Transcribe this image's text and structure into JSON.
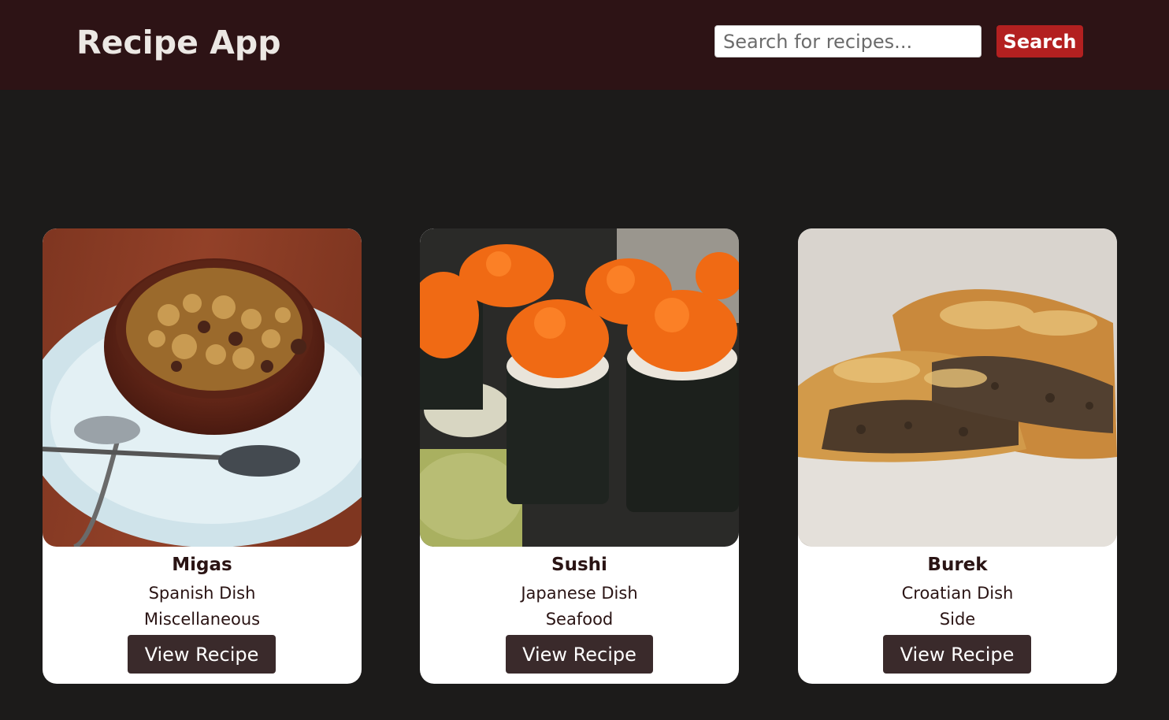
{
  "header": {
    "title": "Recipe App",
    "search_placeholder": "Search for recipes...",
    "search_button": "Search"
  },
  "recipes": [
    {
      "name": "Migas",
      "area": "Spanish Dish",
      "category": "Miscellaneous",
      "button": "View Recipe"
    },
    {
      "name": "Sushi",
      "area": "Japanese Dish",
      "category": "Seafood",
      "button": "View Recipe"
    },
    {
      "name": "Burek",
      "area": "Croatian Dish",
      "category": "Side",
      "button": "View Recipe"
    }
  ],
  "colors": {
    "header_bg": "#2d1315",
    "page_bg": "#1c1b1a",
    "search_button_bg": "#b32020",
    "view_button_bg": "#3a2a2b"
  }
}
